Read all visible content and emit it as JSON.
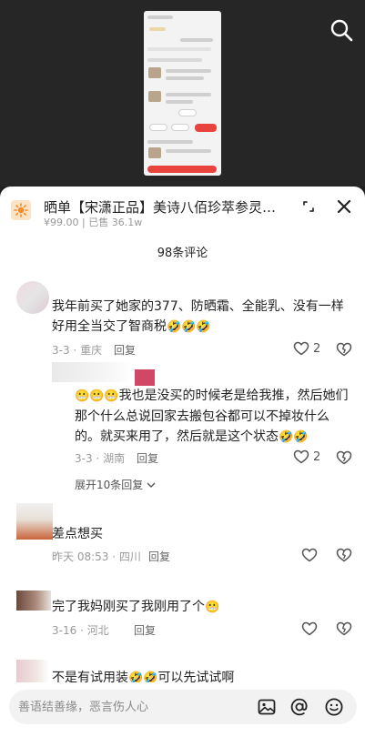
{
  "product": {
    "title": "晒单【宋潇正品】美诗八佰珍萃参灵虫…",
    "price": "¥99.00",
    "sold": "已售 36.1w"
  },
  "comment_count": "98条评论",
  "comments": [
    {
      "text": "我年前买了她家的377、防晒霜、全能乳、没有一样好用全当交了智商税",
      "emojis": "🤣🤣🤣",
      "date": "3-3",
      "location": "重庆",
      "reply_label": "回复",
      "likes": "2"
    },
    {
      "text": "我也是没买的时候老是给我推，然后她们那个什么总说回家去搬包谷都可以不掉妆什么的。就买来用了，然后就是这个状态",
      "lead_emojis": "😬😬😬",
      "emojis": "🤣🤣",
      "date": "3-3",
      "location": "湖南",
      "reply_label": "回复",
      "likes": "2"
    },
    {
      "text": "差点想买",
      "date": "昨天 08:53",
      "location": "四川",
      "reply_label": "回复"
    },
    {
      "text": "完了我妈刚买了我刚用了个",
      "emojis": "😬",
      "date": "3-16",
      "location": "河北",
      "reply_label": "回复"
    },
    {
      "text_a": "不是有试用装",
      "emojis_a": "🤣🤣",
      "text_b": "可以先试试啊",
      "partial": true
    }
  ],
  "expand_replies": "展开10条回复",
  "input": {
    "placeholder": "善语结善缘，恶言伤人心"
  },
  "colors": {
    "sheet_bg": "#ffffff",
    "meta_text": "#9a9a9a",
    "video_bg": "#262626"
  },
  "icons": [
    "search-icon",
    "product-icon",
    "expand-icon",
    "close-icon",
    "heart-icon",
    "dislike-icon",
    "image-icon",
    "at-icon",
    "emoji-icon",
    "chevron-down-icon"
  ]
}
